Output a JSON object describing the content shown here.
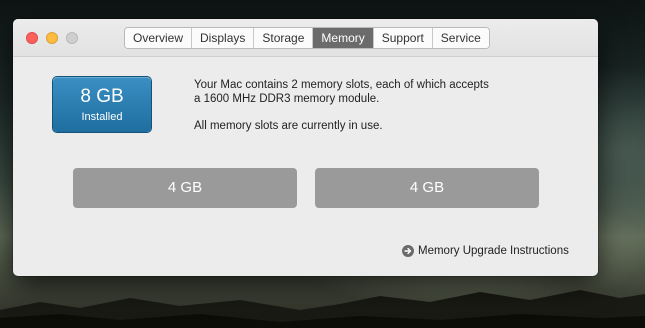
{
  "window": {
    "tabs": [
      {
        "label": "Overview"
      },
      {
        "label": "Displays"
      },
      {
        "label": "Storage"
      },
      {
        "label": "Memory"
      },
      {
        "label": "Support"
      },
      {
        "label": "Service"
      }
    ],
    "active_tab": "Memory"
  },
  "memory": {
    "installed_size": "8 GB",
    "installed_label": "Installed",
    "description_line1": "Your Mac contains 2 memory slots, each of which accepts",
    "description_line2": "a 1600 MHz DDR3 memory module.",
    "status": "All memory slots are currently in use.",
    "slots": [
      {
        "label": "4 GB"
      },
      {
        "label": "4 GB"
      }
    ],
    "upgrade_link": "Memory Upgrade Instructions"
  },
  "colors": {
    "accent_blue": "#2a7fb4",
    "slot_gray": "#9a9a9a",
    "active_tab": "#6b6b6b"
  }
}
